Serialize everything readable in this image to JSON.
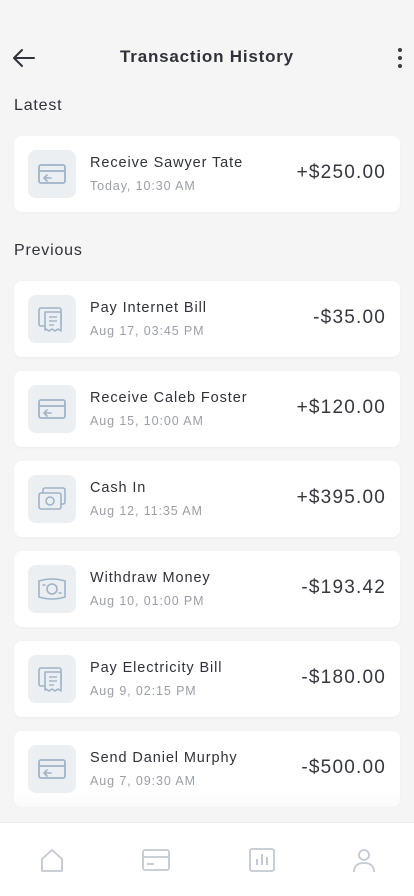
{
  "header": {
    "title": "Transaction History",
    "back_icon": "arrow-left-icon",
    "more_icon": "more-vertical-icon"
  },
  "sections": {
    "latest_label": "Latest",
    "previous_label": "Previous"
  },
  "latest": [
    {
      "name": "Receive Sawyer Tate",
      "date": "Today, 10:30 AM",
      "amount": "+$250.00",
      "icon": "receive-card-icon"
    }
  ],
  "previous": [
    {
      "name": "Pay Internet Bill",
      "date": "Aug 17, 03:45 PM",
      "amount": "-$35.00",
      "icon": "bill-receipt-icon"
    },
    {
      "name": "Receive Caleb Foster",
      "date": "Aug 15, 10:00 AM",
      "amount": "+$120.00",
      "icon": "receive-card-icon"
    },
    {
      "name": "Cash In",
      "date": "Aug 12, 11:35 AM",
      "amount": "+$395.00",
      "icon": "cash-icon"
    },
    {
      "name": "Withdraw Money",
      "date": "Aug 10, 01:00 PM",
      "amount": "-$193.42",
      "icon": "withdraw-money-icon"
    },
    {
      "name": "Pay Electricity Bill",
      "date": "Aug 9, 02:15 PM",
      "amount": "-$180.00",
      "icon": "bill-receipt-icon"
    },
    {
      "name": "Send Daniel Murphy",
      "date": "Aug 7, 09:30 AM",
      "amount": "-$500.00",
      "icon": "send-card-icon"
    }
  ],
  "tabbar": {
    "items": [
      {
        "icon": "home-icon"
      },
      {
        "icon": "card-icon"
      },
      {
        "icon": "chart-icon"
      },
      {
        "icon": "profile-icon"
      }
    ]
  },
  "colors": {
    "background": "#f5f5f6",
    "card": "#ffffff",
    "icon_tile": "#eceff2",
    "icon_stroke": "#9fb3c8",
    "text_primary": "#2f3238",
    "text_secondary": "#9a9ea6"
  }
}
